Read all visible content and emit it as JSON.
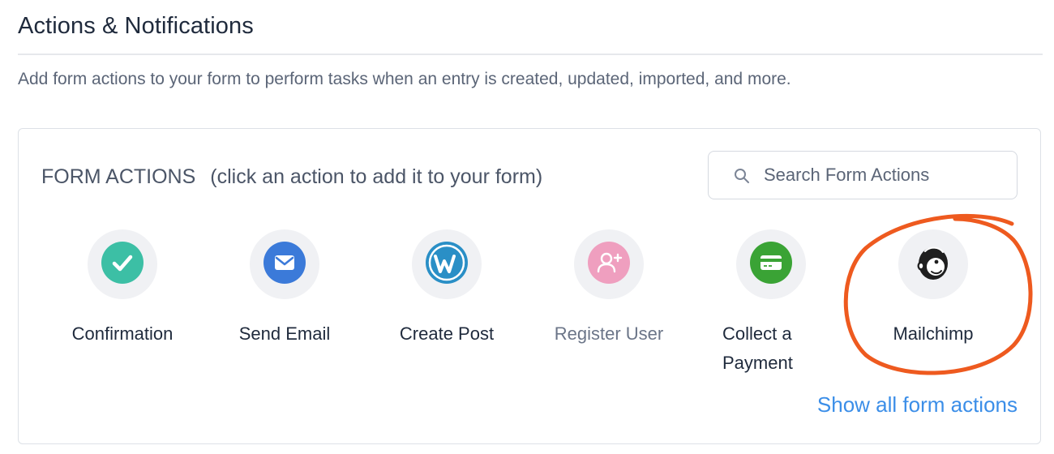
{
  "page": {
    "title": "Actions & Notifications",
    "subtitle": "Add form actions to your form to perform tasks when an entry is created, updated, imported, and more."
  },
  "panel": {
    "header": "FORM ACTIONS",
    "hint": "(click an action to add it to your form)",
    "search": {
      "placeholder": "Search Form Actions",
      "value": "",
      "icon": "search-icon"
    },
    "actions": [
      {
        "label": "Confirmation",
        "icon": "check-icon",
        "color": "#3cbfa5"
      },
      {
        "label": "Send Email",
        "icon": "envelope-icon",
        "color": "#3b7ad9"
      },
      {
        "label": "Create Post",
        "icon": "wordpress-icon",
        "color": "#2a8fc6"
      },
      {
        "label": "Register User",
        "icon": "user-plus-icon",
        "color": "#ef9fbf"
      },
      {
        "label": "Collect a Payment",
        "icon": "credit-card-icon",
        "color": "#3aa335"
      },
      {
        "label": "Mailchimp",
        "icon": "mailchimp-icon",
        "color": "#1f1f1f"
      }
    ],
    "show_all": "Show all form actions"
  },
  "colors": {
    "accent_link": "#3b8ee8",
    "annotation": "#ee5a1f"
  }
}
